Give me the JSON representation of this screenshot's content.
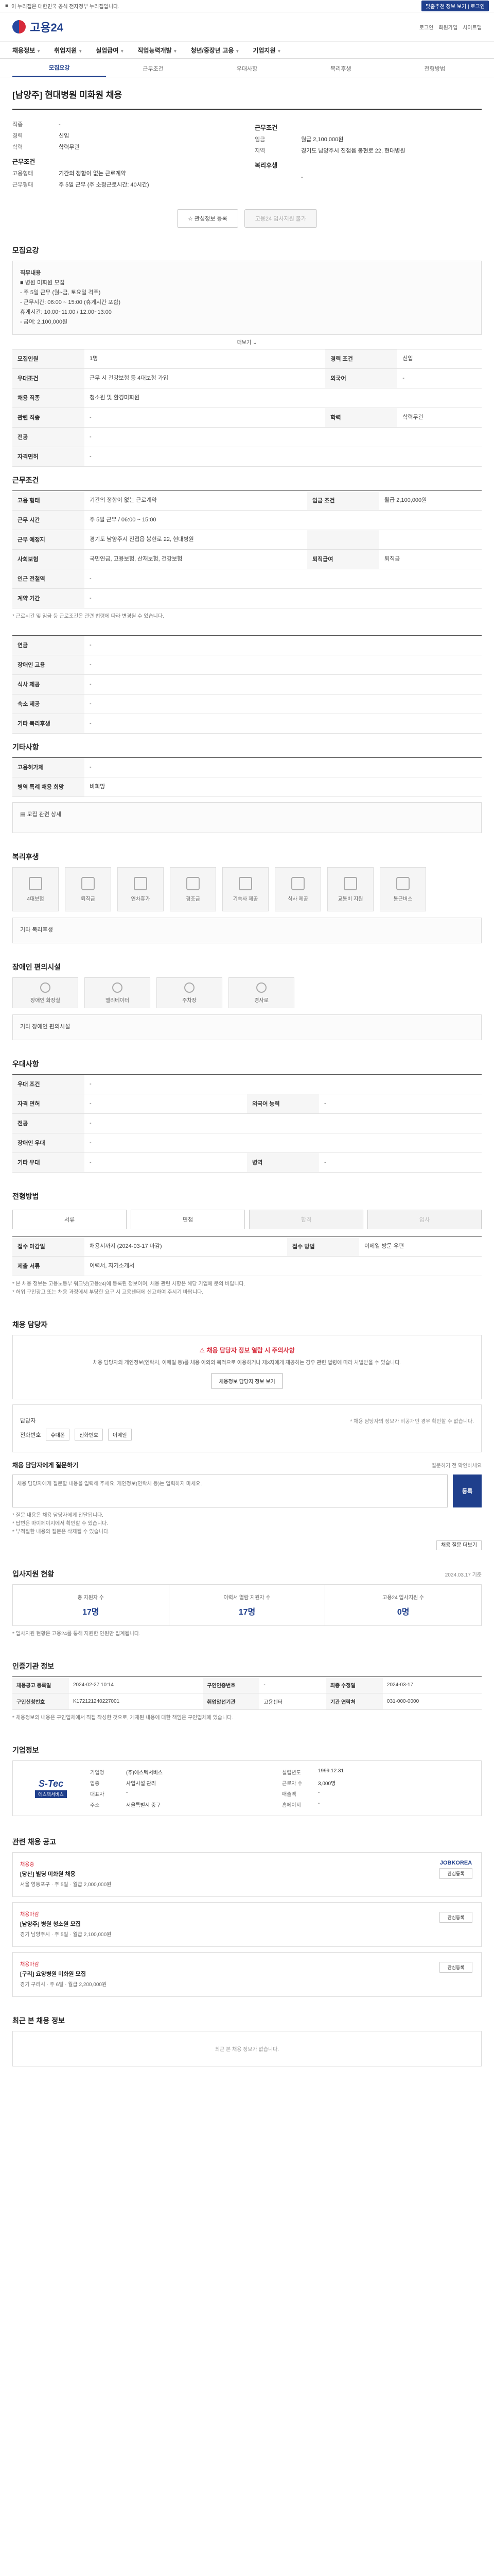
{
  "topbar": {
    "notice": "이 누리집은 대한민국 공식 전자정부 누리집입니다.",
    "right_button": "맞춤추천 정보 보기 | 로그인"
  },
  "header": {
    "logo": "고용24",
    "links": [
      "로그인",
      "회원가입",
      "사이트맵"
    ]
  },
  "nav": [
    "채용정보",
    "취업지원",
    "실업급여",
    "직업능력개발",
    "청년/중장년 고용",
    "기업지원"
  ],
  "subtabs": [
    "모집요강",
    "근무조건",
    "우대사항",
    "복리후생",
    "전형방법"
  ],
  "job": {
    "title": "[남양주] 현대병원 미화원 채용",
    "left": [
      {
        "k": "직종",
        "v": "-"
      },
      {
        "k": "경력",
        "v": "신입"
      },
      {
        "k": "학력",
        "v": "학력무관"
      }
    ],
    "left2_title": "근무조건",
    "left2": [
      {
        "k": "고용형태",
        "v": "기간의 정함이 없는 근로계약"
      },
      {
        "k": "근무형태",
        "v": "주 5일 근무 (주 소정근로시간: 40시간)"
      }
    ],
    "right_title": "근무조건",
    "right": [
      {
        "k": "임금",
        "v": "월급 2,100,000원"
      },
      {
        "k": "지역",
        "v": "경기도 남양주시 진접읍 봉현로 22, 현대병원"
      }
    ],
    "right2_title": "복리후생",
    "right2": [
      {
        "k": "",
        "v": "-"
      }
    ],
    "btn_apply": "관심정보 등록",
    "btn_share": "고용24 입사지원 불가"
  },
  "recruit": {
    "title": "모집요강",
    "box": [
      "직무내용",
      "■ 병원 미화원 모집",
      "- 주 5일 근무 (월~금, 토요일 격주)",
      "- 근무시간: 06:00 ~ 15:00 (휴게시간 포함)",
      "  휴게시간: 10:00~11:00 / 12:00~13:00",
      "- 급여: 2,100,000원"
    ],
    "more": "더보기",
    "rows": [
      {
        "k": "모집인원",
        "v": "1명",
        "k2": "경력 조건",
        "v2": "신입"
      },
      {
        "k": "우대조건",
        "v": "근무 시 건강보험 등 4대보험 가입",
        "k2": "외국어",
        "v2": "-"
      },
      {
        "k": "채용 직종",
        "v": "청소원 및 환경미화원"
      },
      {
        "k": "관련 직종",
        "v": "-",
        "k2": "학력",
        "v2": "학력무관"
      },
      {
        "k": "전공",
        "v": "-"
      },
      {
        "k": "자격면허",
        "v": "-"
      }
    ]
  },
  "work": {
    "title": "근무조건",
    "rows": [
      {
        "k": "고용 형태",
        "v": "기간의 정함이 없는 근로계약",
        "k2": "임금 조건",
        "v2": "월급 2,100,000원"
      },
      {
        "k": "근무 시간",
        "v": "주 5일 근무 / 06:00 ~ 15:00"
      },
      {
        "k": "근무 예정지",
        "v": "경기도 남양주시 진접읍 봉현로 22, 현대병원",
        "k2": "",
        "v2": ""
      },
      {
        "k": "사회보험",
        "v": "국민연금, 고용보험, 산재보험, 건강보험",
        "k2": "퇴직급여",
        "v2": "퇴직금"
      },
      {
        "k": "인근 전철역",
        "v": "-"
      },
      {
        "k": "계약 기간",
        "v": "-"
      }
    ],
    "note": "* 근로시간 및 임금 등 근로조건은 관련 법령에 따라 변경될 수 있습니다."
  },
  "welfare_pre": {
    "rows": [
      {
        "k": "연금",
        "v": "-"
      },
      {
        "k": "장애인 고용",
        "v": "-"
      },
      {
        "k": "식사 제공",
        "v": "-"
      },
      {
        "k": "숙소 제공",
        "v": "-"
      },
      {
        "k": "기타 복리후생",
        "v": "-"
      }
    ]
  },
  "extra": {
    "title": "기타사항",
    "rows": [
      {
        "k": "고용허가제",
        "v": "-"
      },
      {
        "k": "병역 특례 채용 희망",
        "v": "비희망"
      }
    ],
    "extra_note": "모집 관련 상세"
  },
  "benefits": {
    "title": "복리후생",
    "icons": [
      "4대보험",
      "퇴직금",
      "연차휴가",
      "경조금",
      "기숙사 제공",
      "식사 제공",
      "교통비 지원",
      "통근버스"
    ],
    "note": "기타 복리후생"
  },
  "disability": {
    "title": "장애인 편의시설",
    "icons": [
      "장애인 화장실",
      "엘리베이터",
      "주차장",
      "경사로"
    ],
    "note": "기타 장애인 편의시설"
  },
  "pref": {
    "title": "우대사항",
    "rows": [
      {
        "k": "우대 조건",
        "v": "-"
      },
      {
        "k": "자격 면허",
        "v": "-",
        "k2": "외국어 능력",
        "v2": "-"
      },
      {
        "k": "전공",
        "v": "-"
      },
      {
        "k": "장애인 우대",
        "v": "-"
      },
      {
        "k": "기타 우대",
        "v": "-",
        "k2": "병역",
        "v2": "-"
      }
    ]
  },
  "process": {
    "title": "전형방법",
    "steps": [
      "서류",
      "면접",
      "합격",
      "입사"
    ],
    "rows": [
      {
        "k": "접수 마감일",
        "v": "채용시까지 (2024-03-17 마감)",
        "k2": "접수 방법",
        "v2": "이메일 방문 우편"
      },
      {
        "k": "제출 서류",
        "v": "이력서, 자기소개서"
      }
    ],
    "notes": [
      "* 본 채용 정보는 고용노동부 워크넷(고용24)에 등록된 정보이며, 채용 관련 사항은 해당 기업에 문의 바랍니다.",
      "* 허위 구인광고 또는 채용 과정에서 부당한 요구 시 고용센터에 신고하여 주시기 바랍니다."
    ]
  },
  "contact": {
    "title": "채용 담당자",
    "warn_title": "채용 담당자 정보 열람 시 주의사항",
    "warn_text": "채용 담당자의 개인정보(연락처, 이메일 등)를 채용 이외의 목적으로 이용하거나 제3자에게 제공하는 경우 관련 법령에 따라 처벌받을 수 있습니다.",
    "warn_btn": "채용정보 담당자 정보 보기",
    "name_label": "담당자",
    "tel_label": "전화번호",
    "hint": "* 채용 담당자의 정보가 비공개인 경우 확인할 수 없습니다.",
    "btn1": "휴대폰",
    "btn2": "전화번호",
    "btn3": "이메일",
    "q_title": "채용 담당자에게 질문하기",
    "q_hint": "질문하기 전 확인하세요",
    "q_placeholder": "채용 담당자에게 질문할 내용을 입력해 주세요. 개인정보(연락처 등)는 입력하지 마세요.",
    "q_send": "등록",
    "q_notes": [
      "* 질문 내용은 채용 담당자에게 전달됩니다.",
      "* 답변은 마이페이지에서 확인할 수 있습니다.",
      "* 부적절한 내용의 질문은 삭제될 수 있습니다."
    ],
    "q_more": "채용 질문 더보기"
  },
  "applicant": {
    "title": "입사지원 현황",
    "hint": "2024.03.17 기준",
    "stats": [
      {
        "label": "총 지원자 수",
        "num": "17명"
      },
      {
        "label": "이력서 열람 지원자 수",
        "num": "17명"
      },
      {
        "label": "고용24 입사지원 수",
        "num": "0명"
      }
    ],
    "note": "* 입사지원 현황은 고용24를 통해 지원한 인원만 집계됩니다."
  },
  "info": {
    "title": "인증기관 정보",
    "rows": [
      {
        "k": "채용공고 등록일",
        "v": "2024-02-27 10:14",
        "k2": "구인인증번호",
        "v2": "-",
        "k3": "최종 수정일",
        "v3": "2024-03-17"
      },
      {
        "k": "구인신청번호",
        "v": "K172121240227001",
        "k2": "취업알선기관",
        "v2": "고용센터",
        "k3": "기관 연락처",
        "v3": "031-000-0000"
      }
    ],
    "note": "* 채용정보의 내용은 구인업체에서 직접 작성한 것으로, 게재된 내용에 대한 책임은 구인업체에 있습니다."
  },
  "company": {
    "title": "기업정보",
    "logo_a": "S-Tec",
    "logo_b": "에스텍서비스",
    "rows": [
      {
        "k": "기업명",
        "v": "(주)에스텍서비스",
        "k2": "설립년도",
        "v2": "1999.12.31"
      },
      {
        "k": "업종",
        "v": "사업시설 관리",
        "k2": "근로자 수",
        "v2": "3,000명"
      },
      {
        "k": "대표자",
        "v": "-",
        "k2": "매출액",
        "v2": "-"
      },
      {
        "k": "주소",
        "v": "서울특별시 중구",
        "k2": "홈페이지",
        "v2": "-"
      }
    ]
  },
  "related": {
    "title": "관련 채용 공고",
    "items": [
      {
        "tag": "채용중",
        "name": "[당산] 빌딩 미화원 채용",
        "info": "서울 영등포구 · 주 5일 · 월급 2,000,000원",
        "logo": "JOBKOREA",
        "btn": "관심등록"
      },
      {
        "tag": "채용마감",
        "name": "[남양주] 병원 청소원 모집",
        "info": "경기 남양주시 · 주 5일 · 월급 2,100,000원",
        "logo": "",
        "btn": "관심등록"
      },
      {
        "tag": "채용마감",
        "name": "[구리] 요양병원 미화원 모집",
        "info": "경기 구리시 · 주 6일 · 월급 2,200,000원",
        "logo": "",
        "btn": "관심등록"
      }
    ]
  },
  "recent": {
    "title": "최근 본 채용 정보",
    "empty": "최근 본 채용 정보가 없습니다."
  }
}
